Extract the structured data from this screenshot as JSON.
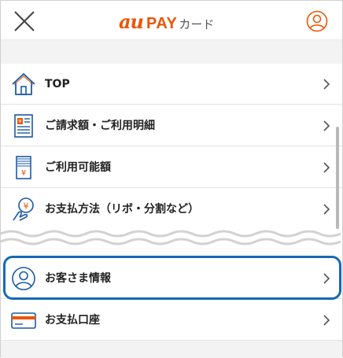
{
  "header": {
    "logo_au": "au",
    "logo_pay": "PAY",
    "logo_card": "カード",
    "brand_color": "#eb5505",
    "close_icon": "close-icon",
    "account_icon": "user-circle-icon"
  },
  "menu": {
    "items": [
      {
        "label": "TOP",
        "icon": "home-icon"
      },
      {
        "label": "ご請求額・ご利用明細",
        "icon": "invoice-icon"
      },
      {
        "label": "ご利用可能額",
        "icon": "available-amount-icon"
      },
      {
        "label": "お支払方法（リボ・分割など）",
        "icon": "payment-method-icon"
      },
      {
        "label": "お客さま情報",
        "icon": "user-circle-icon"
      },
      {
        "label": "お支払口座",
        "icon": "bank-card-icon"
      }
    ],
    "highlighted_index": 4,
    "highlight_color": "#1769b5"
  }
}
